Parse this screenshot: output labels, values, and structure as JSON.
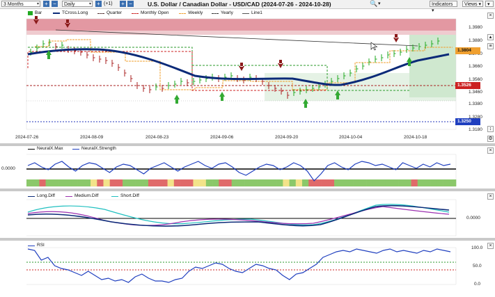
{
  "toolbar": {
    "range": "3 Months",
    "interval": "Daily",
    "offset": "(+1)",
    "title": "U.S. Dollar / Canadian Dollar - USD/CAD (2024-07-26 - 2024-10-28)",
    "indicators_label": "Indicators",
    "views_label": "Views"
  },
  "legend": {
    "bar": "Bar",
    "tcross": "TCross.Long",
    "quarter": "Quarter",
    "monthly": "Monthly Open",
    "weekly": "Weekly",
    "yearly": "Yearly",
    "line1": "Line1"
  },
  "price_axis": [
    "1.3980",
    "1.3880",
    "1.3760",
    "1.3660",
    "1.3560",
    "1.3460",
    "1.3380",
    "1.3280",
    "1.3180"
  ],
  "price_boxes": {
    "current": "1.3804",
    "quarter": "1.3526",
    "low": "1.3250"
  },
  "dates": [
    "2024-07-26",
    "2024-08-09",
    "2024-08-23",
    "2024-09-06",
    "2024-09-20",
    "2024-10-04",
    "2024-10-18"
  ],
  "neural": {
    "max": "NeuralX.Max",
    "strength": "NeuralX.Strength",
    "zero": "0.0000"
  },
  "diff": {
    "long": "Long.Diff",
    "medium": "Medium.Diff",
    "short": "Short.Diff",
    "zero": "0.0000"
  },
  "rsi": {
    "label": "RSI",
    "ticks": [
      "100.0",
      "50.0",
      "0.0"
    ]
  },
  "colors": {
    "up": "#22aa22",
    "down": "#aa2222",
    "tcross": "#0b2a78",
    "monthly": "#cc2222",
    "weekly": "#f0a030",
    "quarter": "#553333",
    "yearly": "#333333"
  }
}
